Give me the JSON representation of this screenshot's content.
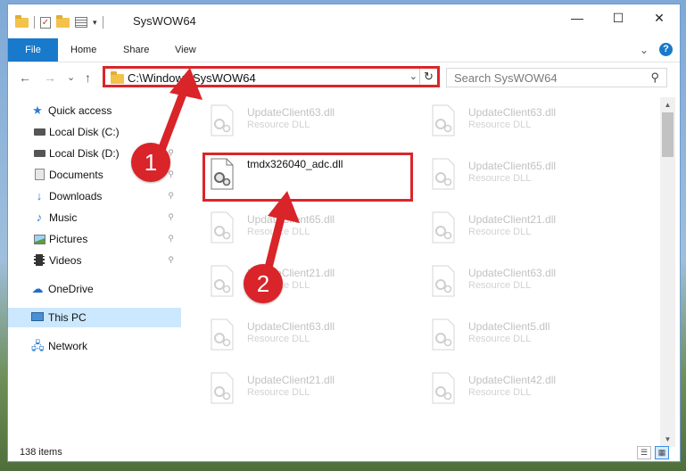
{
  "window": {
    "title": "SysWOW64",
    "controls": {
      "minimize": "—",
      "maximize": "☐",
      "close": "✕"
    }
  },
  "ribbon": {
    "tabs": [
      "File",
      "Home",
      "Share",
      "View"
    ],
    "expand_glyph": "⌄",
    "help_glyph": "?"
  },
  "navigation": {
    "back": "←",
    "forward": "→",
    "recent": "⌄",
    "up": "↑",
    "address": "C:\\Windows\\SysWOW64",
    "address_dropdown": "⌄",
    "refresh": "↻",
    "search_placeholder": "Search SysWOW64",
    "search_glyph": "⚲"
  },
  "sidebar": {
    "items": [
      {
        "label": "Quick access",
        "icon": "star-icon",
        "pinned": false
      },
      {
        "label": "Local Disk (C:)",
        "icon": "drive-icon",
        "pinned": true
      },
      {
        "label": "Local Disk (D:)",
        "icon": "drive-icon",
        "pinned": true
      },
      {
        "label": "Documents",
        "icon": "documents-icon",
        "pinned": true
      },
      {
        "label": "Downloads",
        "icon": "downloads-icon",
        "pinned": true
      },
      {
        "label": "Music",
        "icon": "music-icon",
        "pinned": true
      },
      {
        "label": "Pictures",
        "icon": "pictures-icon",
        "pinned": true
      },
      {
        "label": "Videos",
        "icon": "videos-icon",
        "pinned": true
      },
      {
        "label": "OneDrive",
        "icon": "onedrive-icon",
        "pinned": false
      },
      {
        "label": "This PC",
        "icon": "this-pc-icon",
        "pinned": false,
        "selected": true
      },
      {
        "label": "Network",
        "icon": "network-icon",
        "pinned": false
      }
    ],
    "pin_glyph": "📌"
  },
  "files": {
    "left_column": [
      {
        "name": "UpdateClient63.dll",
        "type": "Resource DLL",
        "faded": true
      },
      {
        "name": "tmdx326040_adc.dll",
        "type": "",
        "faded": false
      },
      {
        "name": "UpdateClient65.dll",
        "type": "Resource DLL",
        "faded": true
      },
      {
        "name": "UpdateClient21.dll",
        "type": "Resource DLL",
        "faded": true
      },
      {
        "name": "UpdateClient63.dll",
        "type": "Resource DLL",
        "faded": true
      },
      {
        "name": "UpdateClient21.dll",
        "type": "Resource DLL",
        "faded": true
      }
    ],
    "right_column": [
      {
        "name": "UpdateClient63.dll",
        "type": "Resource DLL",
        "faded": true
      },
      {
        "name": "UpdateClient65.dll",
        "type": "Resource DLL",
        "faded": true
      },
      {
        "name": "UpdateClient21.dll",
        "type": "Resource DLL",
        "faded": true
      },
      {
        "name": "UpdateClient63.dll",
        "type": "Resource DLL",
        "faded": true
      },
      {
        "name": "UpdateClient5.dll",
        "type": "Resource DLL",
        "faded": true
      },
      {
        "name": "UpdateClient42.dll",
        "type": "Resource DLL",
        "faded": true
      }
    ]
  },
  "status": {
    "item_count": "138 items"
  },
  "annotations": {
    "step1": "1",
    "step2": "2",
    "color": "#d92429"
  },
  "colors": {
    "accent": "#1979ca",
    "selection": "#cce8ff",
    "highlight": "#d9262b"
  }
}
